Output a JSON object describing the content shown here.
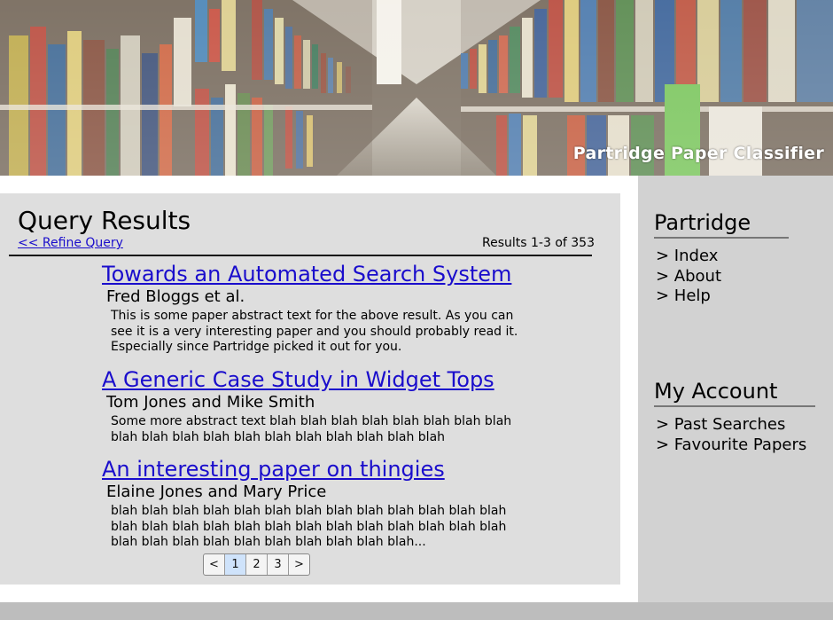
{
  "header": {
    "site_title": "Partridge Paper Classifier",
    "banner_image": "library-bookshelves-photo"
  },
  "main": {
    "title": "Query Results",
    "refine_link": "<< Refine Query",
    "results_count": "Results 1-3 of 353",
    "results": [
      {
        "title": "Towards an Automated Search System",
        "authors": "Fred Bloggs et al.",
        "abstract": "This is some paper abstract text for the above result. As you can see it is a very interesting paper and you should probably read it. Especially since Partridge picked it out for you."
      },
      {
        "title": "A Generic Case Study in Widget Tops",
        "authors": "Tom Jones and Mike Smith",
        "abstract": "Some more abstract text blah blah blah blah blah blah blah blah blah blah blah blah blah blah blah blah blah blah blah"
      },
      {
        "title": "An interesting paper on thingies",
        "authors": "Elaine Jones and Mary Price",
        "abstract": "blah blah blah blah blah blah blah blah blah blah blah blah blah blah blah blah blah blah blah blah blah blah blah blah blah blah blah blah blah blah blah blah blah blah blah blah..."
      }
    ],
    "pager": {
      "prev": "<",
      "pages": [
        "1",
        "2",
        "3"
      ],
      "current": "1",
      "next": ">"
    }
  },
  "sidebar": {
    "partridge": {
      "heading": "Partridge",
      "items": [
        "> Index",
        "> About",
        "> Help"
      ]
    },
    "account": {
      "heading": "My Account",
      "items": [
        "> Past Searches",
        "> Favourite Papers"
      ]
    }
  },
  "colors": {
    "link": "#1a0dcc",
    "main_panel": "#dedede",
    "sidebar": "#d2d2d2",
    "footer": "#bdbdbd",
    "pager_active": "#cfe3fb"
  }
}
